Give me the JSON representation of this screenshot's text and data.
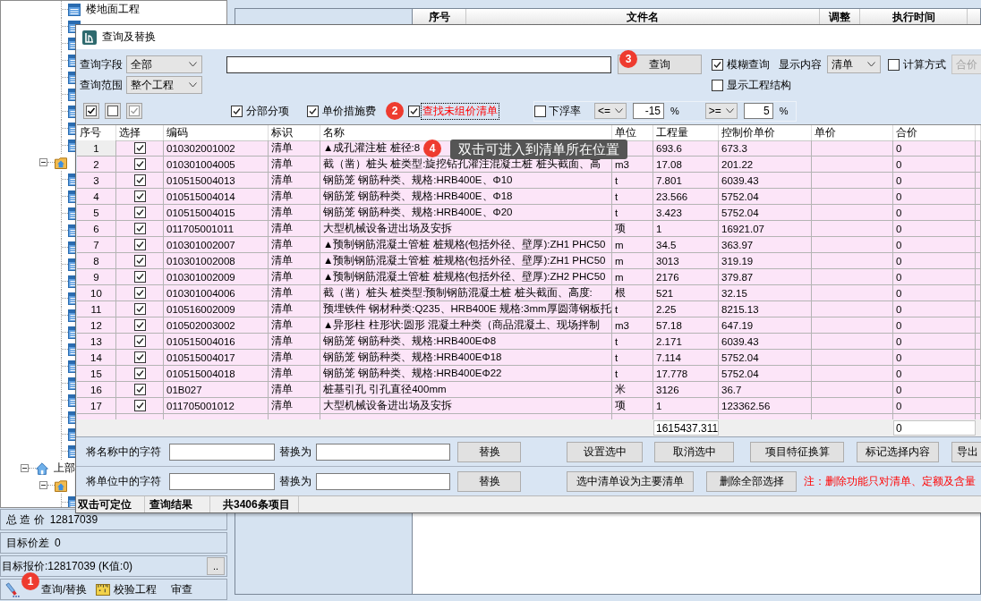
{
  "main_window": {
    "tree": {
      "items": [
        {
          "kind": "unit",
          "children": [
            {
              "kind": "group",
              "children": [
                {
                  "kind": "leaf",
                  "label": "楼地面工程"
                },
                {
                  "kind": "leaf"
                },
                {
                  "kind": "leaf"
                },
                {
                  "kind": "leaf"
                },
                {
                  "kind": "leaf"
                },
                {
                  "kind": "leaf"
                },
                {
                  "kind": "leaf"
                },
                {
                  "kind": "leaf"
                },
                {
                  "kind": "leaf"
                }
              ]
            },
            {
              "kind": "group",
              "expanded": true,
              "children": [
                {
                  "kind": "leaf"
                },
                {
                  "kind": "leaf"
                },
                {
                  "kind": "leaf"
                },
                {
                  "kind": "leaf"
                },
                {
                  "kind": "leaf"
                },
                {
                  "kind": "leaf"
                },
                {
                  "kind": "leaf"
                },
                {
                  "kind": "leaf"
                },
                {
                  "kind": "leaf"
                },
                {
                  "kind": "leaf"
                },
                {
                  "kind": "leaf"
                },
                {
                  "kind": "leaf"
                },
                {
                  "kind": "leaf"
                },
                {
                  "kind": "leaf"
                },
                {
                  "kind": "leaf"
                },
                {
                  "kind": "leaf"
                },
                {
                  "kind": "leaf"
                }
              ]
            }
          ]
        },
        {
          "kind": "unit",
          "label": "上部",
          "expanded": true,
          "children": [
            {
              "kind": "group",
              "expanded": true,
              "children": [
                {
                  "kind": "leaf"
                }
              ]
            }
          ]
        }
      ]
    },
    "summary": {
      "total_label": "总 造 价",
      "total_value": "12817039",
      "diff_label": "目标价差",
      "diff_value": "0",
      "quote": "目标报价:12817039 (K值:0)",
      "more_button": ".."
    },
    "toolbar": [
      {
        "kind": "brush",
        "label": "查询/替换",
        "marker": "1"
      },
      {
        "kind": "ruler",
        "label": "校验工程"
      },
      {
        "kind": "plain",
        "label": "审查"
      }
    ],
    "file_list": {
      "columns": [
        "序号",
        "文件名",
        "调整",
        "执行时间"
      ]
    }
  },
  "dialog": {
    "title": "查询及替换",
    "query_field": {
      "label": "查询字段",
      "value": "全部"
    },
    "query_scope": {
      "label": "查询范围",
      "value": "整个工程"
    },
    "query_button": {
      "label": "查询",
      "marker": "3"
    },
    "fuzzy": {
      "label": "模糊查询",
      "checked": true
    },
    "display": {
      "label": "显示内容",
      "value": "清单"
    },
    "calc_mode": {
      "label": "计算方式",
      "checked": false
    },
    "total_button": {
      "label": "合价",
      "disabled": true
    },
    "show_structure": {
      "label": "显示工程结构",
      "checked": false
    },
    "filters": [
      {
        "kind": "plain",
        "label": "分部分项",
        "checked": true,
        "focused": false
      },
      {
        "kind": "plain",
        "label": "单价措施费",
        "checked": true,
        "focused": false
      },
      {
        "kind": "alert",
        "label": "查找未组价清单",
        "checked": true,
        "focused": true,
        "marker": "2"
      }
    ],
    "float_rate": {
      "label": "下浮率",
      "checked": false,
      "lower_op": "<=",
      "lower_value": "-15",
      "lower_unit": "%",
      "upper_op": ">=",
      "upper_value": "5",
      "upper_unit": "%"
    },
    "table": {
      "columns": [
        "序号",
        "选择",
        "编码",
        "标识",
        "名称",
        "单位",
        "工程量",
        "控制价单价",
        "单价",
        "合价"
      ],
      "rows": [
        {
          "no": "1",
          "selected": true,
          "checked": true,
          "code": "010302001002",
          "mark": "清单",
          "name": "▲成孔灌注桩 桩径:8",
          "quantity": "693.6",
          "control_price": "673.3",
          "total": "0"
        },
        {
          "no": "2",
          "selected": false,
          "checked": true,
          "code": "010301004005",
          "mark": "清单",
          "name": "截（凿）桩头 桩类型:旋挖钻孔灌注混凝土桩 桩头截面、高",
          "unit": "m3",
          "quantity": "17.08",
          "control_price": "201.22",
          "total": "0"
        },
        {
          "no": "3",
          "selected": false,
          "checked": true,
          "code": "010515004013",
          "mark": "清单",
          "name": "钢筋笼 钢筋种类、规格:HRB400E、Φ10",
          "unit": "t",
          "quantity": "7.801",
          "control_price": "6039.43",
          "total": "0"
        },
        {
          "no": "4",
          "selected": false,
          "checked": true,
          "code": "010515004014",
          "mark": "清单",
          "name": "钢筋笼 钢筋种类、规格:HRB400E、Φ18",
          "unit": "t",
          "quantity": "23.566",
          "control_price": "5752.04",
          "total": "0"
        },
        {
          "no": "5",
          "selected": false,
          "checked": true,
          "code": "010515004015",
          "mark": "清单",
          "name": "钢筋笼 钢筋种类、规格:HRB400E、Φ20",
          "unit": "t",
          "quantity": "3.423",
          "control_price": "5752.04",
          "total": "0"
        },
        {
          "no": "6",
          "selected": false,
          "checked": true,
          "code": "011705001011",
          "mark": "清单",
          "name": "大型机械设备进出场及安拆",
          "unit": "项",
          "quantity": "1",
          "control_price": "16921.07",
          "total": "0"
        },
        {
          "no": "7",
          "selected": false,
          "checked": true,
          "code": "010301002007",
          "mark": "清单",
          "name": "▲预制钢筋混凝土管桩 桩规格(包括外径、壁厚):ZH1 PHC50",
          "unit": "m",
          "quantity": "34.5",
          "control_price": "363.97",
          "total": "0"
        },
        {
          "no": "8",
          "selected": false,
          "checked": true,
          "code": "010301002008",
          "mark": "清单",
          "name": "▲预制钢筋混凝土管桩 桩规格(包括外径、壁厚):ZH1 PHC50",
          "unit": "m",
          "quantity": "3013",
          "control_price": "319.19",
          "total": "0"
        },
        {
          "no": "9",
          "selected": false,
          "checked": true,
          "code": "010301002009",
          "mark": "清单",
          "name": "▲预制钢筋混凝土管桩 桩规格(包括外径、壁厚):ZH2 PHC50",
          "unit": "m",
          "quantity": "2176",
          "control_price": "379.87",
          "total": "0"
        },
        {
          "no": "10",
          "selected": false,
          "checked": true,
          "code": "010301004006",
          "mark": "清单",
          "name": "截（凿）桩头 桩类型:预制钢筋混凝土桩 桩头截面、高度:",
          "unit": "根",
          "quantity": "521",
          "control_price": "32.15",
          "total": "0"
        },
        {
          "no": "11",
          "selected": false,
          "checked": true,
          "code": "010516002009",
          "mark": "清单",
          "name": "预埋铁件 钢材种类:Q235、HRB400E 规格:3mm厚圆薄钢板托",
          "unit": "t",
          "quantity": "2.25",
          "control_price": "8215.13",
          "total": "0"
        },
        {
          "no": "12",
          "selected": false,
          "checked": true,
          "code": "010502003002",
          "mark": "清单",
          "name": "▲异形柱 柱形状:圆形 混凝土种类（商品混凝土、现场拌制",
          "unit": "m3",
          "quantity": "57.18",
          "control_price": "647.19",
          "total": "0"
        },
        {
          "no": "13",
          "selected": false,
          "checked": true,
          "code": "010515004016",
          "mark": "清单",
          "name": "钢筋笼 钢筋种类、规格:HRB400EΦ8",
          "unit": "t",
          "quantity": "2.171",
          "control_price": "6039.43",
          "total": "0"
        },
        {
          "no": "14",
          "selected": false,
          "checked": true,
          "code": "010515004017",
          "mark": "清单",
          "name": "钢筋笼 钢筋种类、规格:HRB400EΦ18",
          "unit": "t",
          "quantity": "7.114",
          "control_price": "5752.04",
          "total": "0"
        },
        {
          "no": "15",
          "selected": false,
          "checked": true,
          "code": "010515004018",
          "mark": "清单",
          "name": "钢筋笼 钢筋种类、规格:HRB400EΦ22",
          "unit": "t",
          "quantity": "17.778",
          "control_price": "5752.04",
          "total": "0"
        },
        {
          "no": "16",
          "selected": false,
          "checked": true,
          "code": "01B027",
          "mark": "清单",
          "name": "桩基引孔 引孔直径400mm",
          "unit": "米",
          "quantity": "3126",
          "control_price": "36.7",
          "total": "0"
        },
        {
          "no": "17",
          "selected": false,
          "checked": true,
          "code": "011705001012",
          "mark": "清单",
          "name": "大型机械设备进出场及安拆",
          "unit": "项",
          "quantity": "1",
          "control_price": "123362.56",
          "total": "0"
        }
      ],
      "totals": {
        "quantity": "1615437.311",
        "total": "0"
      }
    },
    "tooltip": {
      "text": "双击可进入到清单所在位置",
      "marker": "4"
    },
    "replace_rows": [
      {
        "label": "将名称中的字符",
        "with_label": "替换为",
        "button": "替换",
        "actions": [
          "设置选中",
          "取消选中",
          "项目特征换算",
          "标记选择内容",
          "导出"
        ]
      },
      {
        "label": "将单位中的字符",
        "with_label": "替换为",
        "button": "替换",
        "actions": [
          "选中清单设为主要清单",
          "删除全部选择"
        ],
        "note": "注：删除功能只对清单、定额及含量"
      }
    ],
    "status_bar": [
      "双击可定位",
      "查询结果",
      "共3406条项目"
    ]
  }
}
